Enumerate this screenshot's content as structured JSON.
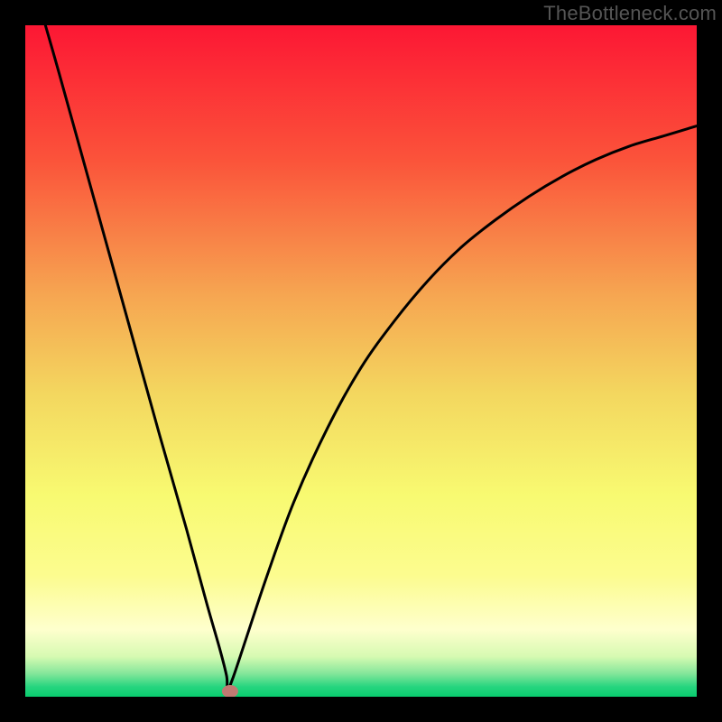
{
  "watermark": "TheBottleneck.com",
  "chart_data": {
    "type": "line",
    "title": "",
    "xlabel": "",
    "ylabel": "",
    "xlim": [
      0,
      100
    ],
    "ylim": [
      0,
      100
    ],
    "series": [
      {
        "name": "curve",
        "x": [
          3,
          5,
          10,
          15,
          20,
          24,
          27,
          29,
          30,
          30.1,
          31,
          33,
          36,
          40,
          45,
          50,
          55,
          60,
          65,
          70,
          75,
          80,
          85,
          90,
          95,
          100
        ],
        "values": [
          100,
          93,
          75,
          57,
          39,
          25,
          14,
          7,
          3,
          1,
          3,
          9,
          18,
          29,
          40,
          49,
          56,
          62,
          67,
          71,
          74.5,
          77.5,
          80,
          82,
          83.5,
          85
        ]
      }
    ],
    "marker": {
      "x": 30.5,
      "y": 0.8,
      "color": "#c07a72"
    },
    "background_gradient": {
      "stops": [
        {
          "pct": 0,
          "color": "#fc1734"
        },
        {
          "pct": 0.2,
          "color": "#fb533a"
        },
        {
          "pct": 0.4,
          "color": "#f6a551"
        },
        {
          "pct": 0.55,
          "color": "#f3d75f"
        },
        {
          "pct": 0.7,
          "color": "#f8fa71"
        },
        {
          "pct": 0.82,
          "color": "#fcfc8f"
        },
        {
          "pct": 0.9,
          "color": "#feffcd"
        },
        {
          "pct": 0.94,
          "color": "#d7fab2"
        },
        {
          "pct": 0.965,
          "color": "#86e79b"
        },
        {
          "pct": 0.985,
          "color": "#27d57f"
        },
        {
          "pct": 1.0,
          "color": "#08cc6e"
        }
      ]
    }
  }
}
